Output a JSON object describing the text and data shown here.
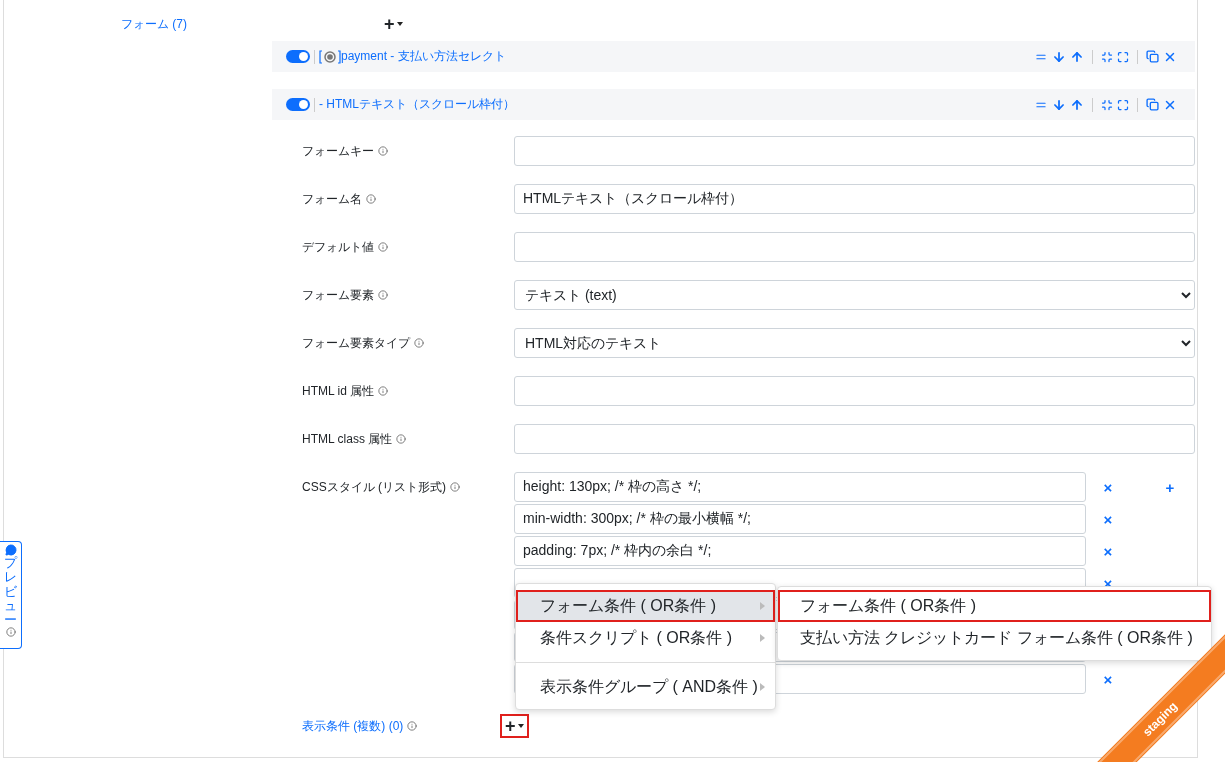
{
  "section": {
    "label": "フォーム (7)",
    "add_button": "+"
  },
  "items": [
    {
      "enabled": true,
      "kind": "radio",
      "title": "payment - 支払い方法セレクト"
    },
    {
      "enabled": true,
      "kind": "text",
      "title": "- HTMLテキスト（スクロール枠付）"
    }
  ],
  "fields": [
    {
      "kind": "input",
      "label": "フォームキー"
    },
    {
      "kind": "input",
      "label": "フォーム名",
      "value": "HTMLテキスト（スクロール枠付）"
    },
    {
      "kind": "input",
      "label": "デフォルト値"
    },
    {
      "kind": "select",
      "label": "フォーム要素",
      "value": "テキスト (text)"
    },
    {
      "kind": "select",
      "label": "フォーム要素タイプ",
      "value": "HTML対応のテキスト"
    },
    {
      "kind": "input",
      "label": "HTML id 属性"
    },
    {
      "kind": "input",
      "label": "HTML class 属性"
    }
  ],
  "css_styles": {
    "label": "CSSスタイル (リスト形式)",
    "add_button": "+",
    "remove_button": "×",
    "rows": [
      {
        "value": "height: 130px; /* 枠の高さ */;"
      },
      {
        "value": "min-width: 300px; /* 枠の最小横幅 */;"
      },
      {
        "value": "padding: 7px; /* 枠内の余白 */;"
      },
      {},
      {},
      {},
      {}
    ]
  },
  "conditions": {
    "label": "表示条件 (複数) (0)",
    "add_button": "+",
    "highlighted": true
  },
  "menu": [
    {
      "label": "フォーム条件 ( OR条件 )",
      "selected": true,
      "highlighted": true,
      "divider_before": false
    },
    {
      "label": "条件スクリプト ( OR条件 )",
      "selected": false,
      "highlighted": false,
      "divider_before": false
    },
    {
      "label": "表示条件グループ ( AND条件 )",
      "selected": false,
      "highlighted": false,
      "divider_before": true
    }
  ],
  "submenu": [
    {
      "label": "フォーム条件 ( OR条件 )",
      "highlighted": true
    },
    {
      "label": "支払い方法 クレジットカード フォーム条件 ( OR条件 )",
      "highlighted": false
    }
  ],
  "preview_tab": {
    "label": "プレビュー"
  },
  "ribbon": {
    "label": "staging"
  }
}
